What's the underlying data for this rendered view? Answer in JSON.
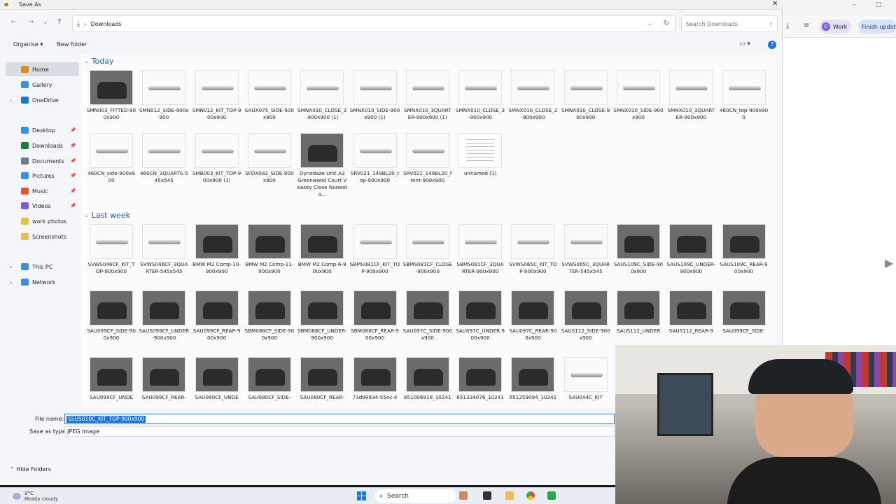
{
  "dialog": {
    "title": "Save As",
    "close_icon": "close-icon"
  },
  "address": {
    "path": "Downloads",
    "search_placeholder": "Search Downloads"
  },
  "commands": {
    "organise": "Organise",
    "new_folder": "New folder"
  },
  "nav": [
    {
      "label": "Home",
      "icon": "home-icon",
      "color": "#d98b2b",
      "selected": true
    },
    {
      "label": "Gallery",
      "icon": "gallery-icon",
      "color": "#3a8fe0"
    },
    {
      "label": "OneDrive",
      "icon": "cloud-icon",
      "color": "#1e74d6",
      "expand": true
    },
    {
      "label": "Desktop",
      "icon": "desktop-icon",
      "color": "#3a8fe0",
      "pin": true
    },
    {
      "label": "Downloads",
      "icon": "download-icon",
      "color": "#1e7a3a",
      "pin": true
    },
    {
      "label": "Documents",
      "icon": "documents-icon",
      "color": "#6b7a8c",
      "pin": true
    },
    {
      "label": "Pictures",
      "icon": "pictures-icon",
      "color": "#3a8fe0",
      "pin": true
    },
    {
      "label": "Music",
      "icon": "music-icon",
      "color": "#e0533a",
      "pin": true
    },
    {
      "label": "Videos",
      "icon": "videos-icon",
      "color": "#7b5fd8",
      "pin": true
    },
    {
      "label": "work photos",
      "icon": "folder-icon",
      "color": "#e8c14a"
    },
    {
      "label": "Screenshots",
      "icon": "folder-icon",
      "color": "#e8c14a"
    },
    {
      "label": "This PC",
      "icon": "pc-icon",
      "color": "#3a8fe0",
      "expand": true
    },
    {
      "label": "Network",
      "icon": "network-icon",
      "color": "#3a8fe0",
      "expand": true
    }
  ],
  "groups": {
    "today": "Today",
    "last_week": "Last week"
  },
  "today_files": [
    {
      "name": "SMN003_FITTED-900x900",
      "photo": true
    },
    {
      "name": "SMN012_SIDE-900x900"
    },
    {
      "name": "SMN012_KIT_TOP-900x900"
    },
    {
      "name": "SAUX075_SIDE-900x900"
    },
    {
      "name": "SMNX010_CLOSE_3-900x900 (1)"
    },
    {
      "name": "SMNX010_SIDE-900x900 (1)"
    },
    {
      "name": "SMNX010_3QUARTER-900x900 (1)"
    },
    {
      "name": "SMNX010_CLOSE_3-900x900"
    },
    {
      "name": "SMNX010_CLOSE_2-900x900"
    },
    {
      "name": "SMNX010_CLOSE-900x900"
    },
    {
      "name": "SMNX010_SIDE-900x900"
    },
    {
      "name": "SMNX010_3QUARTER-900x900"
    },
    {
      "name": "460CN_top-900x900"
    },
    {
      "name": "460CN_side-900x900"
    },
    {
      "name": "460CN_3QUARTS-545x545"
    },
    {
      "name": "SMB003_KIT_TOP-900x900 (1)"
    },
    {
      "name": "SFDX082_SIDE-900x900"
    },
    {
      "name": "Dynodaze Unit A3 Greenwood Court Veasey Close Nuneato...",
      "photo": true
    },
    {
      "name": "SRV021_149BL20_top-900x900"
    },
    {
      "name": "SRV021_149BL20_front-900x900"
    },
    {
      "name": "unnamed (1)",
      "doc": true
    }
  ],
  "week_files": [
    {
      "name": "SVWS046CF_KIT_TOP-900x900"
    },
    {
      "name": "SVWS046CF_3QUARTER-545x545"
    },
    {
      "name": "BMW M2 Comp-10-900x900",
      "photo": true
    },
    {
      "name": "BMW M2 Comp-11-900x900",
      "photo": true
    },
    {
      "name": "BMW M2 Comp-6-900x900",
      "photo": true
    },
    {
      "name": "SBMS081CF_KIT_TOP-900x900"
    },
    {
      "name": "SBMS081CF_CLOSE-900x900"
    },
    {
      "name": "SBMS081CF_3QUARTER-900x900"
    },
    {
      "name": "SVWS065C_KIT_TOP-900x900"
    },
    {
      "name": "SVWS065C_3QUARTER-545x545"
    },
    {
      "name": "SAUS109C_SIDE-900x900",
      "photo": true
    },
    {
      "name": "SAUS109C_UNDER-900x900",
      "photo": true
    },
    {
      "name": "SAUS109C_REAR-900x900",
      "photo": true
    },
    {
      "name": "SAU099CF_SIDE-900x900",
      "photo": true
    },
    {
      "name": "SAUS099CF_UNDER-900x900",
      "photo": true
    },
    {
      "name": "SAU099CF_REAR-900x900",
      "photo": true
    },
    {
      "name": "SBM088CF_SIDE-900x900",
      "photo": true
    },
    {
      "name": "SBM088CF_UNDER-900x900",
      "photo": true
    },
    {
      "name": "SBM088CF_REAR-900x900",
      "photo": true
    },
    {
      "name": "SAU097C_SIDE-900x900",
      "photo": true
    },
    {
      "name": "SAU097C_UNDER-900x900",
      "photo": true
    },
    {
      "name": "SAU097C_REAR-900x900",
      "photo": true
    },
    {
      "name": "SAUS112_SIDE-900x900",
      "photo": true
    },
    {
      "name": "SAUS112_UNDER",
      "photo": true
    },
    {
      "name": "SAUS112_REAR-9",
      "photo": true
    },
    {
      "name": "SAU099CF_SIDE-",
      "photo": true
    },
    {
      "name": "SAU099CF_UNDE",
      "photo": true
    },
    {
      "name": "SAU099CF_REAR-",
      "photo": true
    },
    {
      "name": "SAU080CF_UNDE",
      "photo": true
    },
    {
      "name": "SAU080CF_SIDE-",
      "photo": true
    },
    {
      "name": "SAU080CF_REAR-",
      "photo": true
    },
    {
      "name": "73d99934-55ec-4",
      "photo": true
    },
    {
      "name": "651006918_10241",
      "photo": true
    },
    {
      "name": "651334076_10241",
      "photo": true
    },
    {
      "name": "651259094_10241",
      "photo": true
    },
    {
      "name": "SAU044C_KIT"
    }
  ],
  "bottom": {
    "file_name_label": "File name:",
    "file_name_value": "SSUS010C_KIT_TOP-900x900",
    "save_type_label": "Save as type:",
    "save_type_value": "JPEG Image",
    "hide_folders": "Hide Folders"
  },
  "browser": {
    "work": "Work",
    "work_avatar": "D",
    "finish": "Finish update"
  },
  "taskbar": {
    "temp": "9°C",
    "weather": "Mostly cloudy",
    "search": "Search"
  }
}
